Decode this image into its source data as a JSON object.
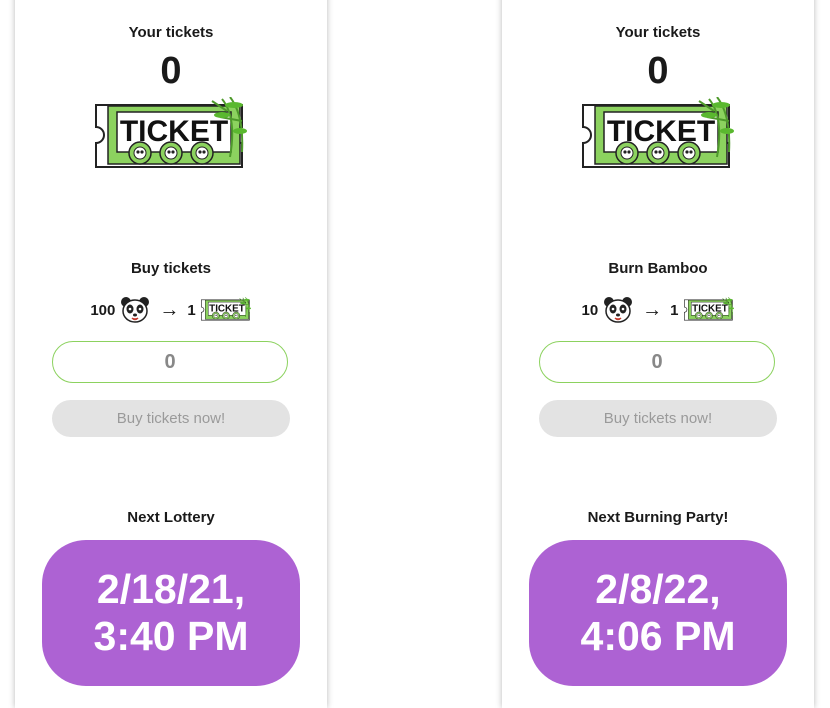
{
  "left": {
    "tickets_label": "Your tickets",
    "tickets_count": "0",
    "ticket_image_text": "TICKET",
    "section_title": "Buy tickets",
    "rate_amount": "100",
    "rate_arrow": "→",
    "rate_result": "1",
    "quantity_value": "0",
    "button_label": "Buy tickets now!",
    "next_label": "Next Lottery",
    "next_date": "2/18/21,",
    "next_time": "3:40 PM"
  },
  "right": {
    "tickets_label": "Your tickets",
    "tickets_count": "0",
    "ticket_image_text": "TICKET",
    "section_title": "Burn Bamboo",
    "rate_amount": "10",
    "rate_arrow": "→",
    "rate_result": "1",
    "quantity_value": "0",
    "button_label": "Buy tickets now!",
    "next_label": "Next Burning Party!",
    "next_date": "2/8/22,",
    "next_time": "4:06 PM"
  },
  "colors": {
    "accent_green": "#8cd25f",
    "date_pill": "#ad62d3",
    "button_disabled": "#e3e3e3"
  },
  "icons": [
    "panda-icon",
    "ticket-icon",
    "arrow-right-icon"
  ]
}
